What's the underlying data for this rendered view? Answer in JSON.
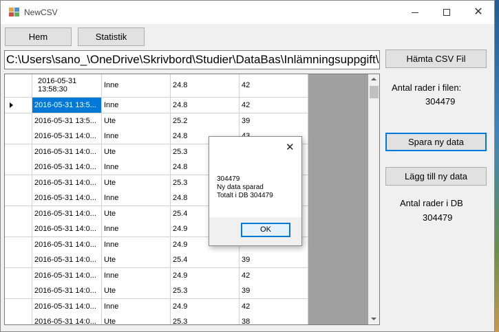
{
  "window": {
    "title": "NewCSV"
  },
  "toolbar": {
    "hem_label": "Hem",
    "statistik_label": "Statistik"
  },
  "path": {
    "value": "C:\\Users\\sano_\\OneDrive\\Skrivbord\\Studier\\DataBas\\Inlämningsuppgift\\Inläm"
  },
  "side": {
    "hamta_label": "Hämta CSV Fil",
    "rows_in_file_label": "Antal rader i filen:",
    "rows_in_file_value": "304479",
    "spara_label": "Spara ny data",
    "lagg_label": "Lägg till ny data",
    "rows_in_db_label": "Antal rader i DB",
    "rows_in_db_value": "304479"
  },
  "grid": {
    "header": [
      "2016-05-31 13:58:30",
      "Inne",
      "24.8",
      "42"
    ],
    "rows": [
      [
        "2016-05-31 13:5...",
        "Inne",
        "24.8",
        "42"
      ],
      [
        "2016-05-31 13:5...",
        "Ute",
        "25.2",
        "39"
      ],
      [
        "2016-05-31 14:0...",
        "Inne",
        "24.8",
        "43"
      ],
      [
        "2016-05-31 14:0...",
        "Ute",
        "25.3",
        ""
      ],
      [
        "2016-05-31 14:0...",
        "Inne",
        "24.8",
        ""
      ],
      [
        "2016-05-31 14:0...",
        "Ute",
        "25.3",
        ""
      ],
      [
        "2016-05-31 14:0...",
        "Inne",
        "24.8",
        ""
      ],
      [
        "2016-05-31 14:0...",
        "Ute",
        "25.4",
        ""
      ],
      [
        "2016-05-31 14:0...",
        "Inne",
        "24.9",
        ""
      ],
      [
        "2016-05-31 14:0...",
        "Inne",
        "24.9",
        ""
      ],
      [
        "2016-05-31 14:0...",
        "Ute",
        "25.4",
        "39"
      ],
      [
        "2016-05-31 14:0...",
        "Inne",
        "24.9",
        "42"
      ],
      [
        "2016-05-31 14:0...",
        "Ute",
        "25.3",
        "39"
      ],
      [
        "2016-05-31 14:0...",
        "Inne",
        "24.9",
        "42"
      ],
      [
        "2016-05-31 14:0...",
        "Ute",
        "25.3",
        "38"
      ]
    ]
  },
  "dialog": {
    "line1": "304479",
    "line2": "Ny data sparad",
    "line3": "Totalt i DB 304479",
    "ok_label": "OK",
    "close_glyph": "✕"
  },
  "icons": {
    "close_glyph": "✕"
  },
  "colors": {
    "accent": "#0078d7",
    "selection": "#0078d7"
  }
}
